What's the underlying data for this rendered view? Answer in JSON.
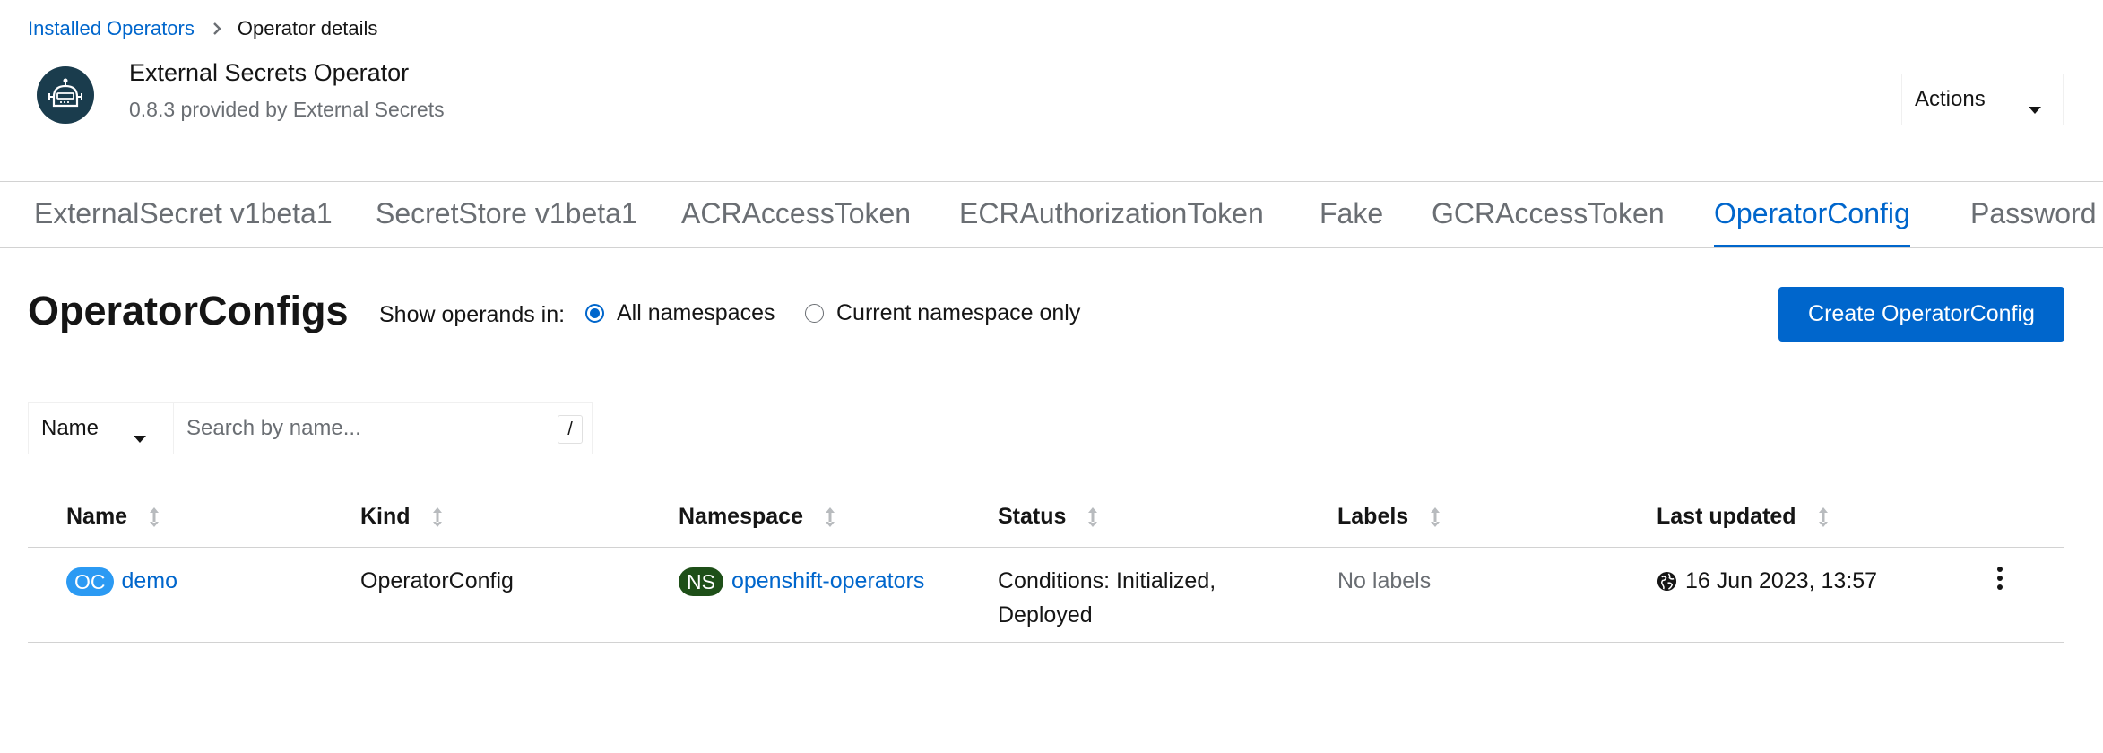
{
  "breadcrumb": {
    "parent": "Installed Operators",
    "current": "Operator details"
  },
  "operator": {
    "name": "External Secrets Operator",
    "subtitle": "0.8.3 provided by External Secrets"
  },
  "actions": {
    "label": "Actions"
  },
  "tabs": [
    {
      "label": "ExternalSecret v1beta1",
      "active": false
    },
    {
      "label": "SecretStore v1beta1",
      "active": false
    },
    {
      "label": "ACRAccessToken",
      "active": false
    },
    {
      "label": "ECRAuthorizationToken",
      "active": false
    },
    {
      "label": "Fake",
      "active": false
    },
    {
      "label": "GCRAccessToken",
      "active": false
    },
    {
      "label": "OperatorConfig",
      "active": true
    },
    {
      "label": "Password",
      "active": false
    }
  ],
  "section": {
    "title": "OperatorConfigs",
    "show_operands_label": "Show operands in:",
    "radio_all": "All namespaces",
    "radio_current": "Current namespace only",
    "create_button": "Create OperatorConfig"
  },
  "filter": {
    "select_value": "Name",
    "search_placeholder": "Search by name...",
    "shortcut_hint": "/"
  },
  "table": {
    "columns": [
      "Name",
      "Kind",
      "Namespace",
      "Status",
      "Labels",
      "Last updated"
    ],
    "rows": [
      {
        "name_badge": "OC",
        "name": "demo",
        "kind": "OperatorConfig",
        "namespace_badge": "NS",
        "namespace": "openshift-operators",
        "status_line1": "Conditions: Initialized,",
        "status_line2": "Deployed",
        "labels": "No labels",
        "last_updated": "16 Jun 2023, 13:57"
      }
    ]
  },
  "colors": {
    "accent": "#0066cc",
    "oc_badge": "#2b9af3",
    "ns_badge": "#1e4f18",
    "logo_bg": "#1a3c4d"
  },
  "icons": {
    "breadcrumb_separator": "chevron-right-icon",
    "logo": "robot-icon",
    "dropdown": "caret-down-icon",
    "sort": "sort-icon",
    "timestamp": "globe-icon",
    "row_actions": "kebab-icon"
  }
}
